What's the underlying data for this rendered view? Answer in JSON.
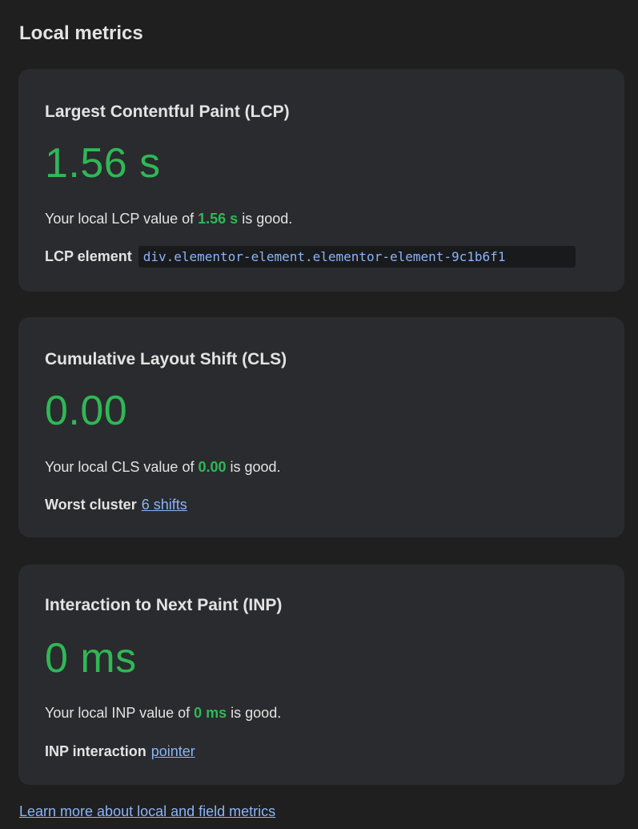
{
  "panel": {
    "title": "Local metrics"
  },
  "colors": {
    "background": "#1f1f1f",
    "card": "#2a2b2e",
    "good": "#2fb856",
    "link": "#8ab4f8"
  },
  "metrics": [
    {
      "title": "Largest Contentful Paint (LCP)",
      "value": "1.56 s",
      "desc_prefix": "Your local LCP value of ",
      "desc_value": "1.56 s",
      "desc_suffix": " is good.",
      "detail_label": "LCP element",
      "detail_value": "div.elementor-element.elementor-element-9c1b6f1"
    },
    {
      "title": "Cumulative Layout Shift (CLS)",
      "value": "0.00",
      "desc_prefix": "Your local CLS value of ",
      "desc_value": "0.00",
      "desc_suffix": " is good.",
      "detail_label": "Worst cluster",
      "detail_value": "6 shifts"
    },
    {
      "title": "Interaction to Next Paint (INP)",
      "value": "0 ms",
      "desc_prefix": "Your local INP value of ",
      "desc_value": "0 ms",
      "desc_suffix": " is good.",
      "detail_label": "INP interaction",
      "detail_value": "pointer"
    }
  ],
  "footer": {
    "link_text": "Learn more about local and field metrics"
  }
}
